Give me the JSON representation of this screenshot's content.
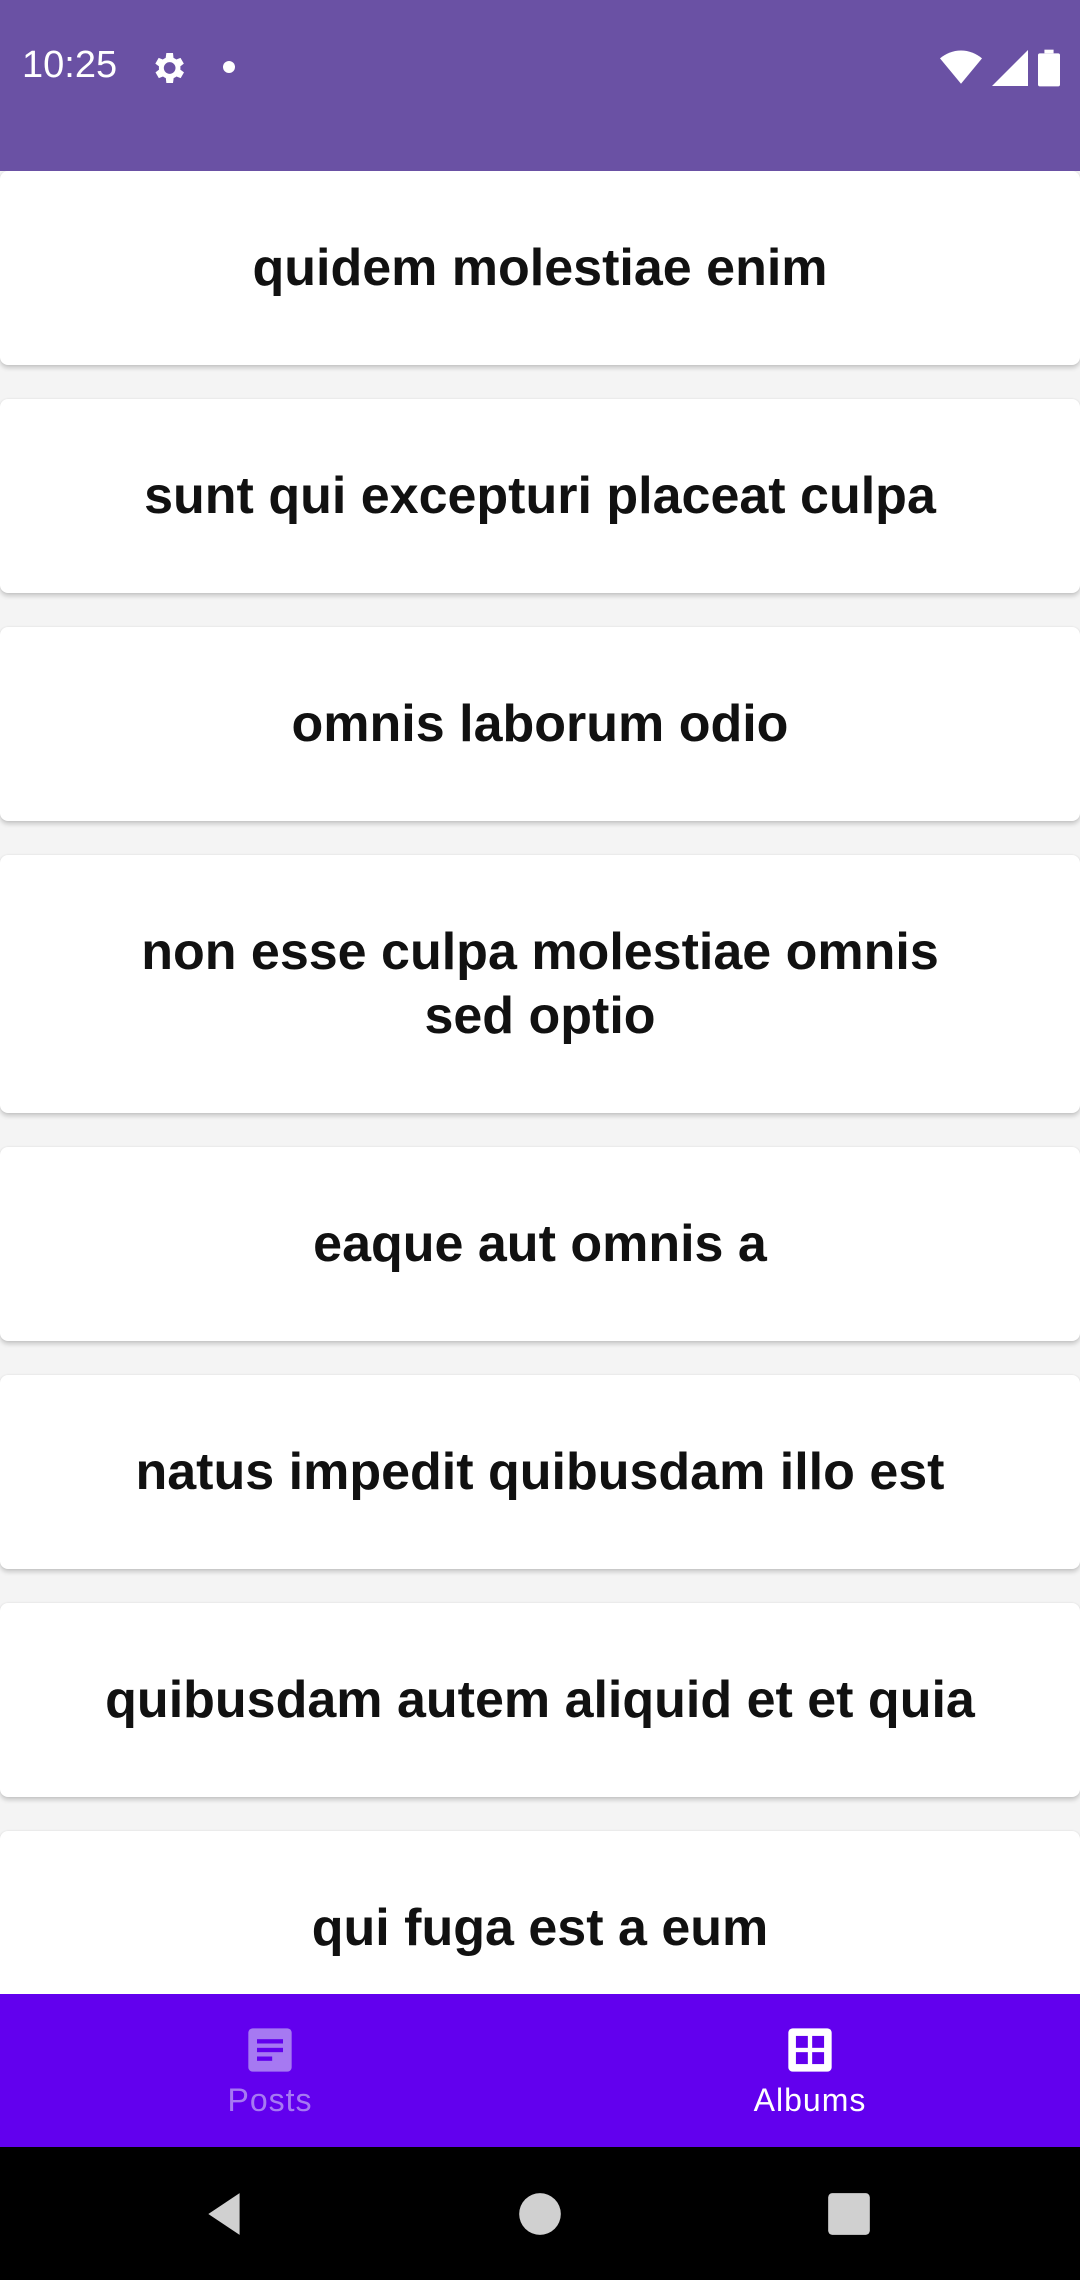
{
  "status_bar": {
    "time": "10:25",
    "icons": [
      "gear-icon",
      "notification-dot-icon",
      "wifi-icon",
      "signal-icon",
      "battery-icon"
    ]
  },
  "albums": [
    {
      "title": "quidem molestiae enim"
    },
    {
      "title": "sunt qui excepturi placeat culpa"
    },
    {
      "title": "omnis laborum odio"
    },
    {
      "title": "non esse culpa molestiae omnis sed optio"
    },
    {
      "title": "eaque aut omnis a"
    },
    {
      "title": "natus impedit quibusdam illo est"
    },
    {
      "title": "quibusdam autem aliquid et et quia"
    },
    {
      "title": "qui fuga est a eum"
    }
  ],
  "bottom_nav": {
    "items": [
      {
        "label": "Posts",
        "icon": "posts-icon",
        "active": false
      },
      {
        "label": "Albums",
        "icon": "albums-grid-icon",
        "active": true
      }
    ]
  },
  "colors": {
    "status_bar": "#6a51a4",
    "bottom_nav": "#6200ee",
    "nav_inactive": "#a679f2",
    "nav_active": "#ffffff"
  }
}
